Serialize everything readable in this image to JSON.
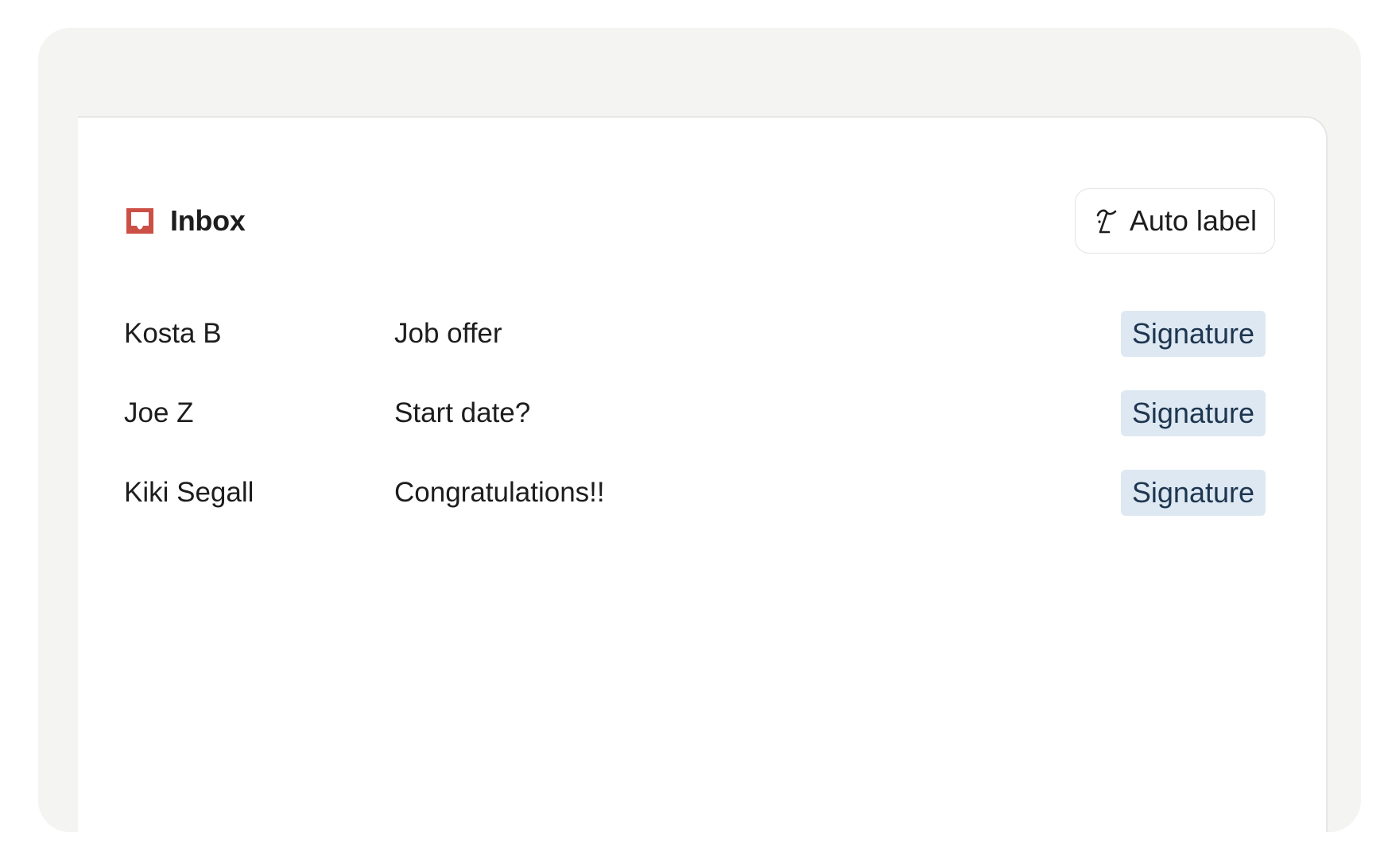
{
  "header": {
    "title": "Inbox",
    "inbox_icon": "inbox-tray-icon",
    "accent_color": "#cc4f45"
  },
  "toolbar": {
    "auto_label_text": "Auto label",
    "auto_label_icon": "handwriting-icon"
  },
  "emails": [
    {
      "sender": "Kosta B",
      "subject": "Job offer",
      "label": "Signature"
    },
    {
      "sender": "Joe Z",
      "subject": "Start date?",
      "label": "Signature"
    },
    {
      "sender": "Kiki Segall",
      "subject": "Congratulations!!",
      "label": "Signature"
    }
  ],
  "colors": {
    "badge_bg": "#dde8f2",
    "badge_text": "#1e3650",
    "frame_bg": "#f4f4f3"
  }
}
